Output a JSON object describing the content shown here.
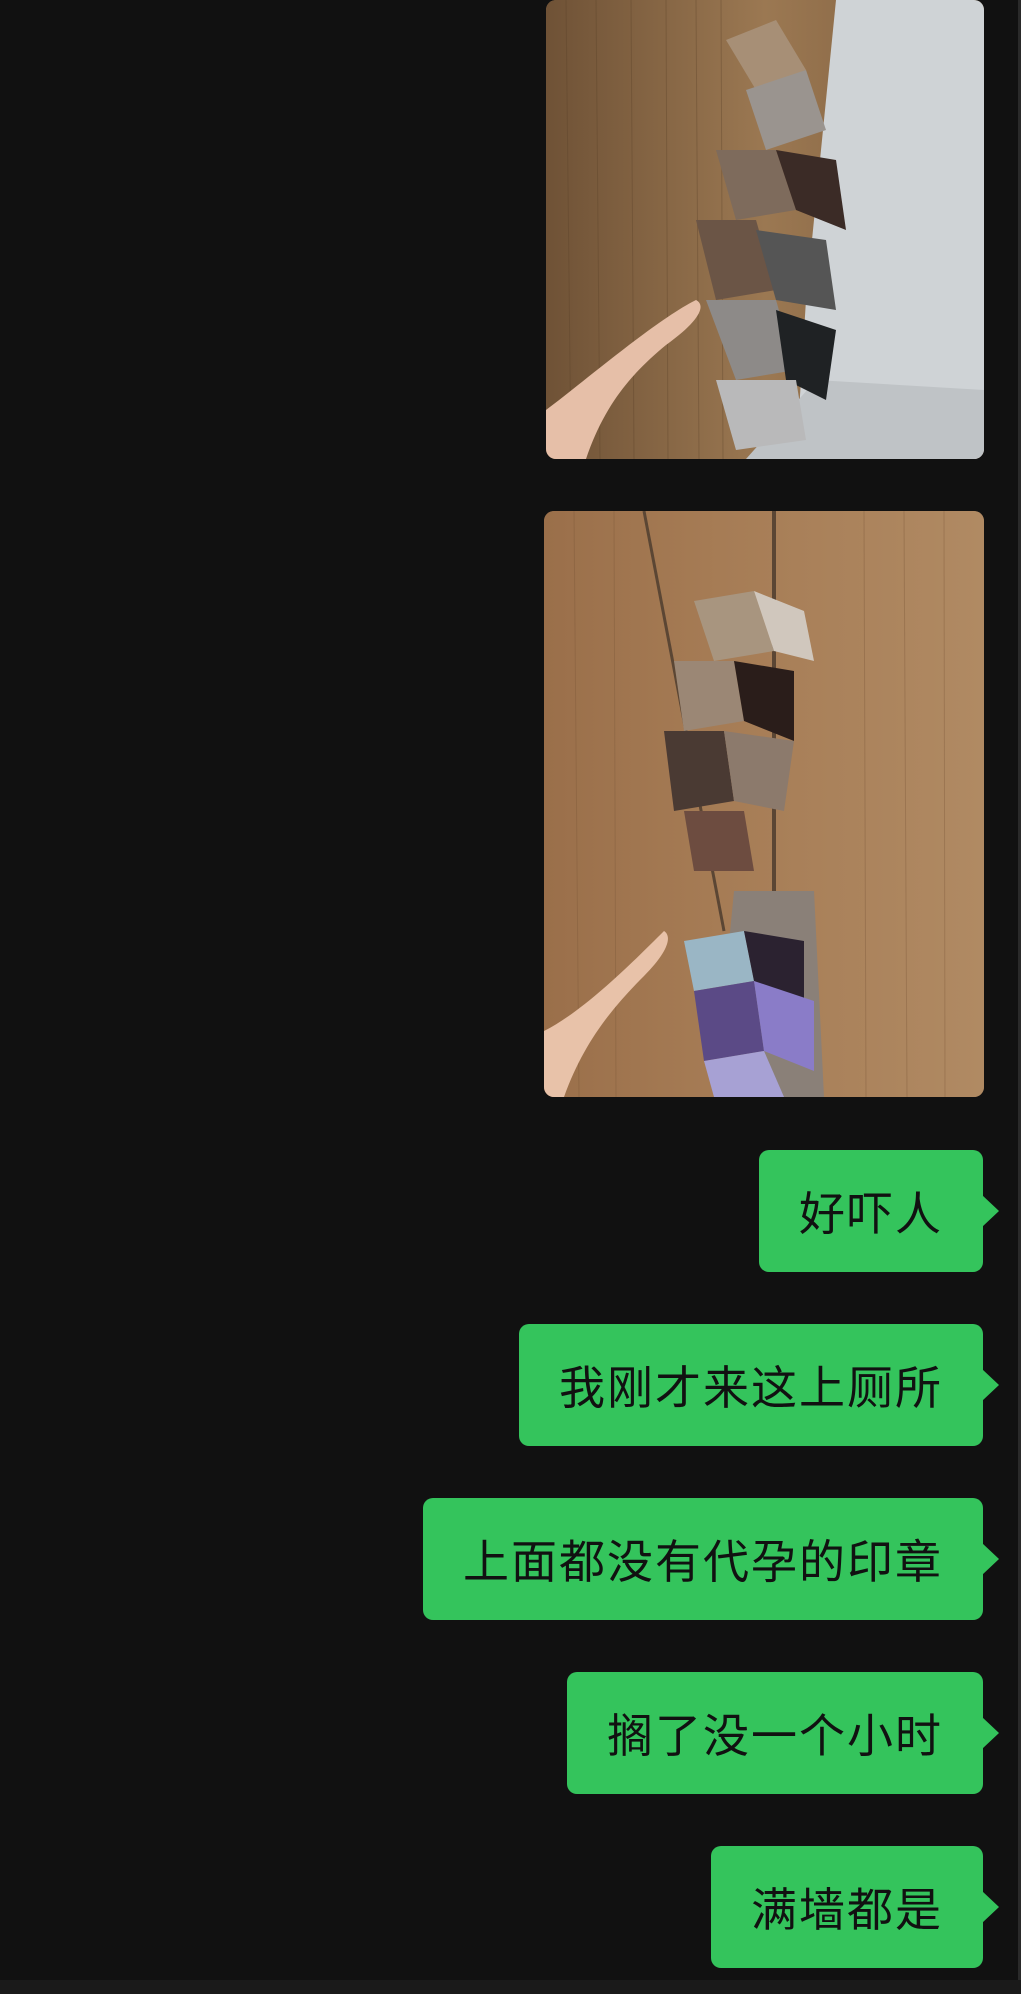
{
  "conversation": {
    "messages": [
      {
        "type": "image",
        "from": "self",
        "alt": "photo 1"
      },
      {
        "type": "image",
        "from": "self",
        "alt": "photo 2"
      },
      {
        "type": "text",
        "from": "self",
        "text": "好吓人"
      },
      {
        "type": "text",
        "from": "self",
        "text": "我刚才来这上厕所"
      },
      {
        "type": "text",
        "from": "self",
        "text": "上面都没有代孕的印章"
      },
      {
        "type": "text",
        "from": "self",
        "text": "搁了没一个小时"
      },
      {
        "type": "text",
        "from": "self",
        "text": "满墙都是"
      }
    ]
  },
  "theme": {
    "background": "#111111",
    "bubble_color": "#34c45c",
    "bubble_text_color": "#111111"
  }
}
